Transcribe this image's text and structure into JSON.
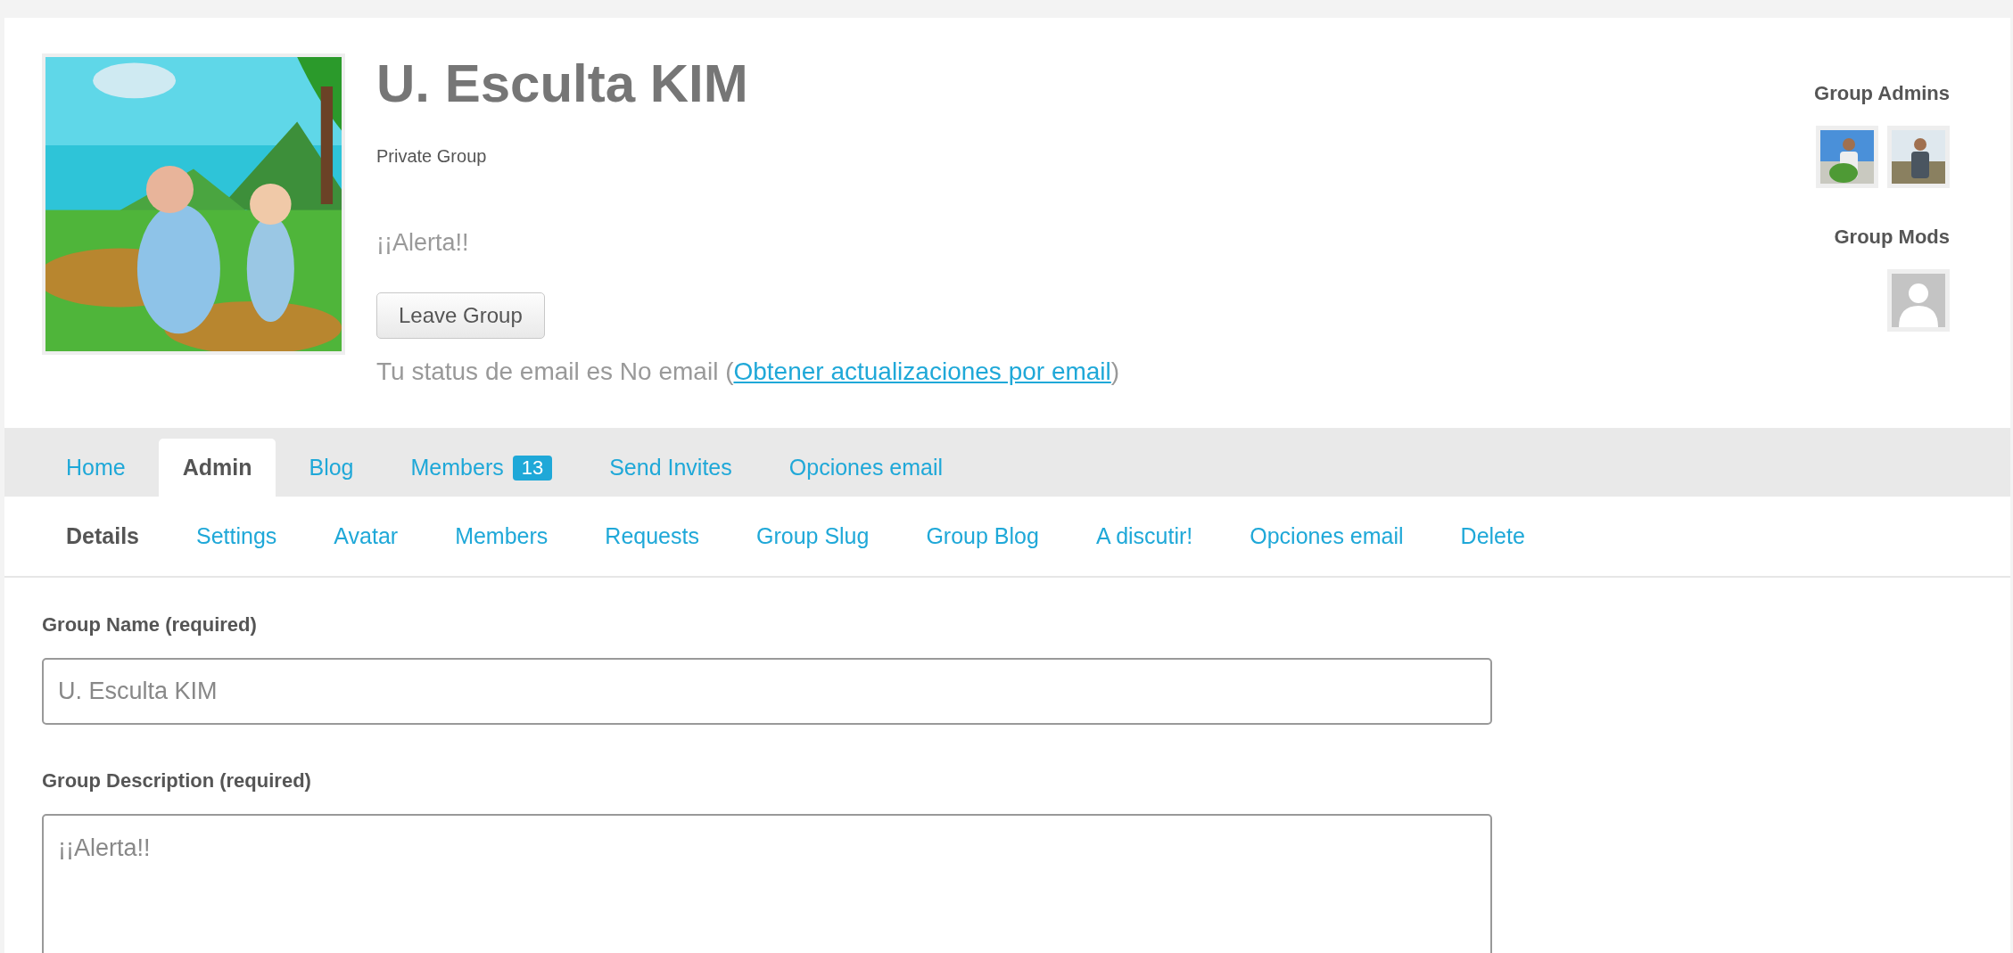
{
  "group": {
    "name": "U. Esculta KIM",
    "privacy": "Private Group",
    "description": "¡¡Alerta!!",
    "leave_button": "Leave Group",
    "email_status": {
      "text": "Tu status de email es No email (",
      "link": "Obtener actualizaciones por email",
      "suffix": ")"
    }
  },
  "sidebar": {
    "admins_heading": "Group Admins",
    "mods_heading": "Group Mods",
    "mods": [
      {
        "kind": "default"
      }
    ]
  },
  "tabs": [
    {
      "label": "Home",
      "selected": false
    },
    {
      "label": "Admin",
      "selected": true
    },
    {
      "label": "Blog",
      "selected": false
    },
    {
      "label": "Members",
      "selected": false,
      "count": "13"
    },
    {
      "label": "Send Invites",
      "selected": false
    },
    {
      "label": "Opciones email",
      "selected": false
    }
  ],
  "subnav": [
    {
      "label": "Details",
      "selected": true
    },
    {
      "label": "Settings",
      "selected": false
    },
    {
      "label": "Avatar",
      "selected": false
    },
    {
      "label": "Members",
      "selected": false
    },
    {
      "label": "Requests",
      "selected": false
    },
    {
      "label": "Group Slug",
      "selected": false
    },
    {
      "label": "Group Blog",
      "selected": false
    },
    {
      "label": "A discutir!",
      "selected": false
    },
    {
      "label": "Opciones email",
      "selected": false
    },
    {
      "label": "Delete",
      "selected": false
    }
  ],
  "form": [
    {
      "label": "Group Name (required)",
      "kind": "input",
      "value": "U. Esculta KIM"
    },
    {
      "label": "Group Description (required)",
      "kind": "textarea",
      "value": "¡¡Alerta!!"
    }
  ]
}
